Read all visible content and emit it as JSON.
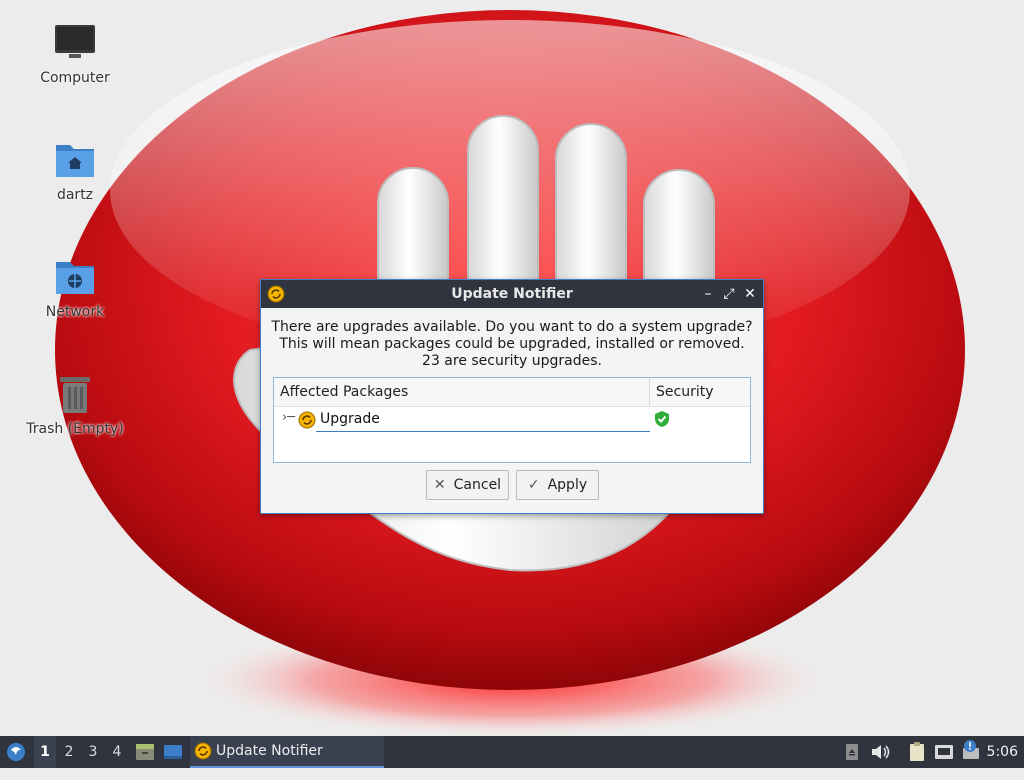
{
  "desktop": {
    "icons": [
      {
        "label": "Computer"
      },
      {
        "label": "dartz"
      },
      {
        "label": "Network"
      },
      {
        "label": "Trash (Empty)"
      }
    ]
  },
  "dialog": {
    "title": "Update Notifier",
    "message_lines": [
      "There are upgrades available. Do you want to do a system upgrade?",
      "This will mean packages could be upgraded, installed or removed.",
      "23 are security upgrades."
    ],
    "table": {
      "columns": [
        "Affected Packages",
        "Security"
      ],
      "rows": [
        {
          "label": "Upgrade",
          "security_icon": "shield-check-icon"
        }
      ]
    },
    "buttons": {
      "cancel": "Cancel",
      "apply": "Apply"
    }
  },
  "taskbar": {
    "workspaces": [
      "1",
      "2",
      "3",
      "4"
    ],
    "active_workspace": "1",
    "task_label": "Update Notifier",
    "clock": "5:06"
  },
  "colors": {
    "panel": "#2f343f",
    "accent": "#3c7fc8",
    "wallpaper_red": "#d8161b",
    "security_green": "#2fae3a",
    "folder_blue": "#4a90d9"
  }
}
